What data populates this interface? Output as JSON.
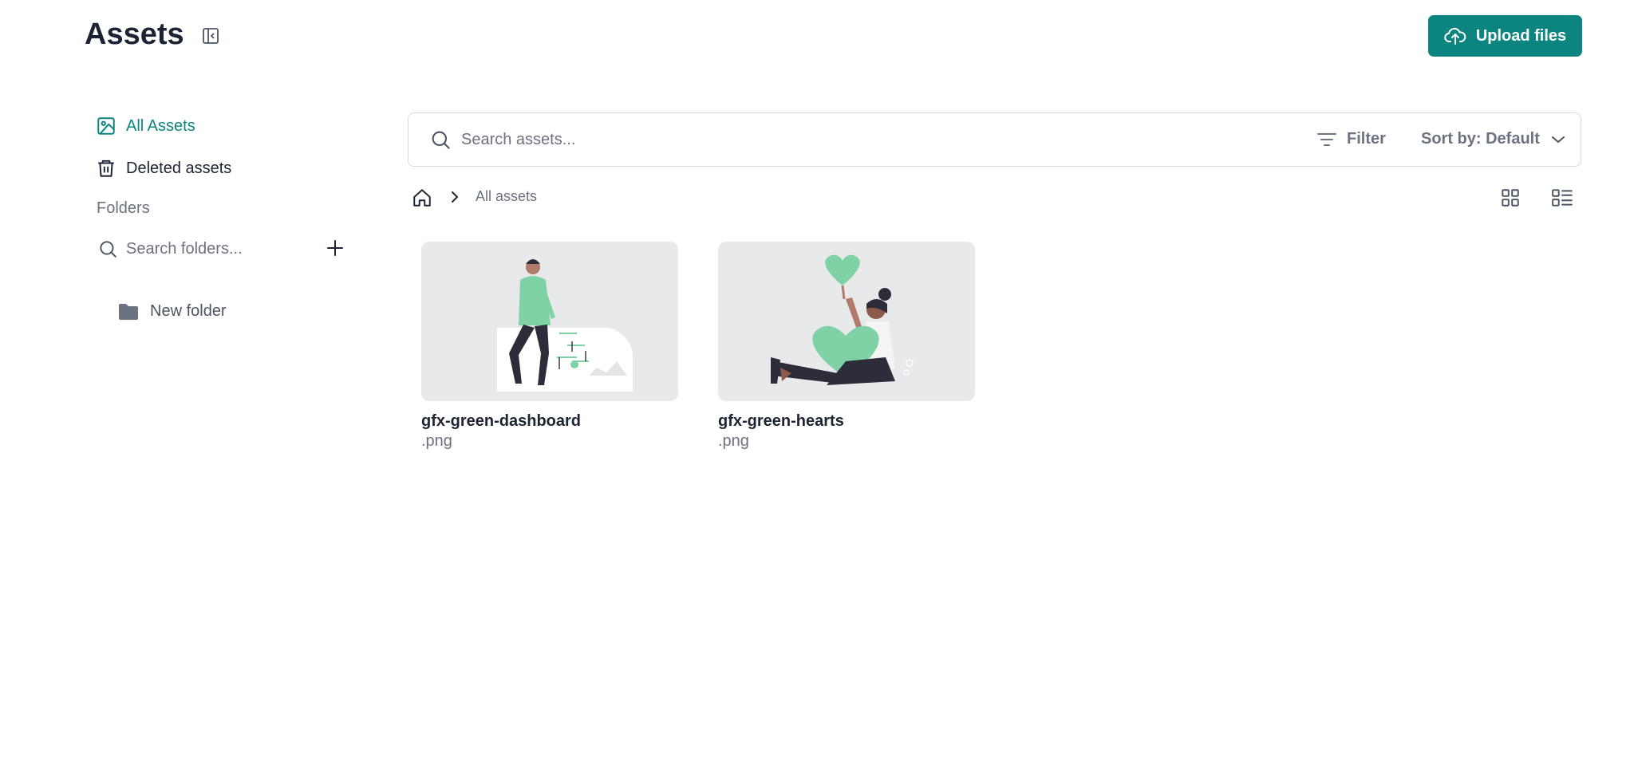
{
  "page": {
    "title": "Assets"
  },
  "header": {
    "upload_label": "Upload files"
  },
  "sidebar": {
    "all_assets_label": "All Assets",
    "deleted_assets_label": "Deleted assets",
    "folders_label": "Folders",
    "folder_search_placeholder": "Search folders...",
    "folders": [
      {
        "label": "New folder"
      }
    ]
  },
  "toolbar": {
    "search_placeholder": "Search assets...",
    "filter_label": "Filter",
    "sort_label": "Sort by: Default"
  },
  "breadcrumb": {
    "current": "All assets"
  },
  "assets": [
    {
      "name": "gfx-green-dashboard",
      "ext": ".png"
    },
    {
      "name": "gfx-green-hearts",
      "ext": ".png"
    }
  ],
  "colors": {
    "accent": "#0c8580",
    "illustration_green": "#7fd1a6",
    "thumb_bg": "#e8e9ea"
  }
}
